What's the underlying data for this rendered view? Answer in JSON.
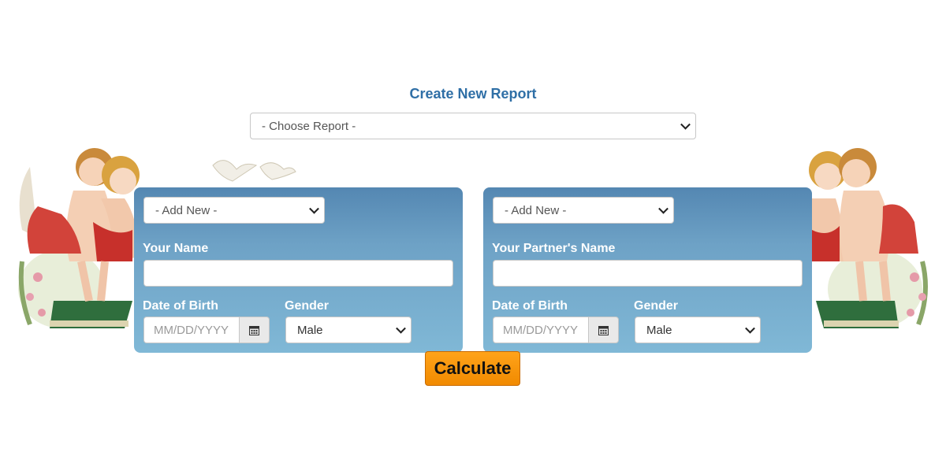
{
  "report": {
    "title": "Create New Report",
    "select_value": "- Choose Report -"
  },
  "left_panel": {
    "add_new": "- Add New -",
    "name_label": "Your Name",
    "name_value": "",
    "dob_label": "Date of Birth",
    "dob_placeholder": "MM/DD/YYYY",
    "gender_label": "Gender",
    "gender_value": "Male"
  },
  "right_panel": {
    "add_new": "- Add New -",
    "name_label": "Your Partner's Name",
    "name_value": "",
    "dob_label": "Date of Birth",
    "dob_placeholder": "MM/DD/YYYY",
    "gender_label": "Gender",
    "gender_value": "Male"
  },
  "actions": {
    "calculate_label": "Calculate"
  },
  "icons": {
    "calendar": "calendar-icon",
    "dropdown": "chevron-down-icon",
    "decoration_left": "cherubs-illustration",
    "decoration_right": "cherubs-illustration",
    "decoration_doves": "doves-illustration"
  },
  "colors": {
    "title": "#2f6fa6",
    "panel_top": "#5487b2",
    "panel_bottom": "#80b8d6",
    "button": "#f18a00"
  }
}
